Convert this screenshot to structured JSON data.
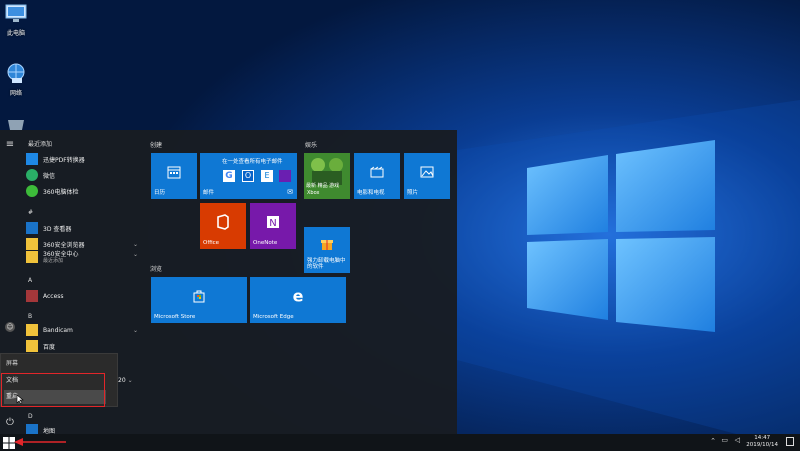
{
  "desktop": {
    "icons": [
      {
        "label": "此电脑"
      },
      {
        "label": "网络"
      }
    ]
  },
  "start_menu": {
    "recently_added": "最近添加",
    "apps": [
      {
        "label": "迅捷PDF转换器"
      },
      {
        "label": "微信"
      },
      {
        "label": "360电脑体检"
      }
    ],
    "sections": [
      "#",
      "A",
      "B",
      "D"
    ],
    "hash_apps": [
      {
        "label": "3D 查看器"
      },
      {
        "label": "360安全浏览器"
      },
      {
        "label": "360安全中心"
      },
      {
        "label": "最近添加"
      }
    ],
    "a_apps": [
      {
        "label": "Access"
      }
    ],
    "b_apps": [
      {
        "label": "Bandicam"
      },
      {
        "label": "百度"
      }
    ],
    "d_apps": [
      {
        "label": "地图"
      }
    ],
    "partial_label": "20"
  },
  "groups": {
    "create": "创建",
    "play": "娱乐",
    "browse": "浏览"
  },
  "tiles": {
    "calendar": "日历",
    "mail_header": "在一处查看所有电子邮件",
    "mail": "邮件",
    "xbox": "Xbox",
    "game_text": "最新 精品 游戏",
    "movies": "电影和电视",
    "photos": "照片",
    "office": "Office",
    "onenote": "OneNote",
    "store": "Microsoft Store",
    "edge": "Microsoft Edge",
    "promo": "强力卸载电脑中的软件"
  },
  "context_menu": {
    "title": "屏幕",
    "items": [
      "文档",
      "重启"
    ]
  },
  "taskbar": {
    "time": "14:47",
    "date": "2019/10/14"
  },
  "colors": {
    "tile_blue": "#0f78d4",
    "office": "#d83b01",
    "onenote": "#7719aa",
    "highlight": "#e2262a"
  }
}
